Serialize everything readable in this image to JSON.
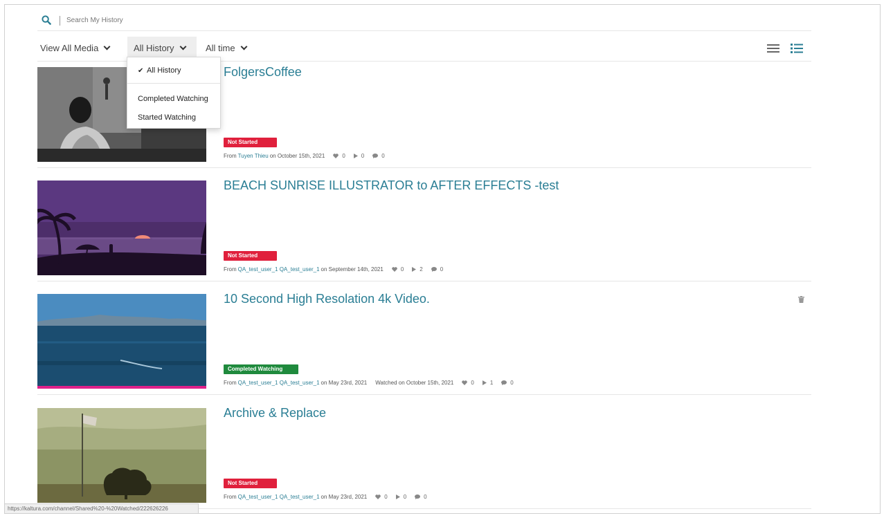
{
  "search": {
    "placeholder": "Search My History"
  },
  "filters": {
    "media": "View All Media",
    "history": "All History",
    "time": "All time"
  },
  "dropdown": {
    "items": [
      {
        "label": "All History",
        "selected": true
      },
      {
        "label": "Completed Watching",
        "selected": false
      },
      {
        "label": "Started Watching",
        "selected": false
      }
    ]
  },
  "entries": [
    {
      "title": "FolgersCoffee",
      "status": "Not Started",
      "from_label": "From",
      "author": "Tuyen Thieu",
      "date": "on October 15th, 2021",
      "likes": "0",
      "plays": "0",
      "comments": "0"
    },
    {
      "title": "BEACH SUNRISE ILLUSTRATOR to AFTER EFFECTS -test",
      "status": "Not Started",
      "from_label": "From",
      "author": "QA_test_user_1 QA_test_user_1",
      "date": "on September 14th, 2021",
      "likes": "0",
      "plays": "2",
      "comments": "0"
    },
    {
      "title": "10 Second High Resolation 4k Video.",
      "status": "Completed Watching",
      "from_label": "From",
      "author": "QA_test_user_1 QA_test_user_1",
      "date": "on May 23rd, 2021",
      "watched": "Watched on October 15th, 2021",
      "likes": "0",
      "plays": "1",
      "comments": "0"
    },
    {
      "title": "Archive & Replace",
      "status": "Not Started",
      "from_label": "From",
      "author": "QA_test_user_1 QA_test_user_1",
      "date": "on May 23rd, 2021",
      "likes": "0",
      "plays": "0",
      "comments": "0"
    }
  ],
  "colors": {
    "accent": "#2a7e94",
    "not_started": "#e0203c",
    "completed": "#1f8a3d"
  },
  "icons": {
    "search": "search-icon",
    "list_view": "list-view-icon",
    "detail_view": "detail-view-icon",
    "like": "heart-icon",
    "play": "play-icon",
    "comment": "comment-icon",
    "delete": "trash-icon"
  },
  "status_bar": {
    "url": "https://kaltura.com/channel/Shared%20-%20Watched/222626226"
  }
}
